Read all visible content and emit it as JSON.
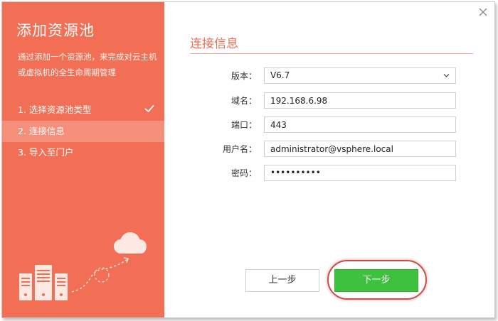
{
  "dialog": {
    "title": "添加资源池",
    "description": "通过添加一个资源池，来完成对云主机或虚拟机的全生命周期管理"
  },
  "steps": [
    {
      "label": "1. 选择资源池类型",
      "state": "done"
    },
    {
      "label": "2. 连接信息",
      "state": "active"
    },
    {
      "label": "3. 导入至门户",
      "state": "pending"
    }
  ],
  "section": {
    "title": "连接信息"
  },
  "form": {
    "version": {
      "label": "版本：",
      "value": "V6.7"
    },
    "domain": {
      "label": "域名：",
      "value": "192.168.6.98"
    },
    "port": {
      "label": "端口：",
      "value": "443"
    },
    "username": {
      "label": "用户名：",
      "value": "administrator@vsphere.local"
    },
    "password": {
      "label": "密码：",
      "value": "••••••••••"
    }
  },
  "buttons": {
    "prev": "上一步",
    "next": "下一步"
  },
  "colors": {
    "accent": "#f26f55",
    "primary_button": "#3ec13e",
    "highlight_ring": "#c8504a"
  },
  "icons": {
    "close": "close-icon",
    "step_done": "check-icon",
    "dropdown": "chevron-down-icon"
  }
}
